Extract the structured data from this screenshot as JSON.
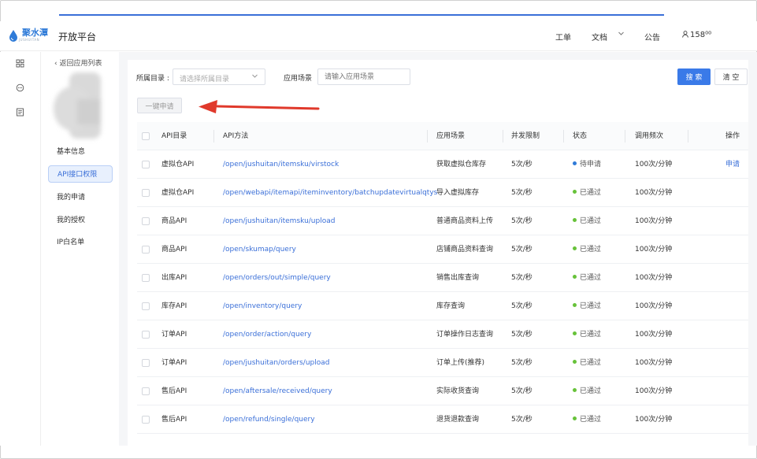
{
  "header": {
    "logo_text": "聚水潭",
    "logo_sub": "JUSHUITAN",
    "title": "开放平台",
    "nav": {
      "workorder": "工单",
      "docs": "文档",
      "notice": "公告",
      "user": "158⁰⁰"
    }
  },
  "sidebar": {
    "back": "返回应用列表",
    "items": [
      {
        "label": "基本信息"
      },
      {
        "label": "API接口权限"
      },
      {
        "label": "我的申请"
      },
      {
        "label": "我的授权"
      },
      {
        "label": "IP白名单"
      }
    ]
  },
  "filters": {
    "category_label": "所属目录 :",
    "category_placeholder": "请选择所属目录",
    "scene_label": "应用场景",
    "scene_placeholder": "请输入应用场景",
    "search_btn": "搜 索",
    "clear_btn": "清 空",
    "apply_btn": "一键申请"
  },
  "table": {
    "headers": {
      "category": "API目录",
      "method": "API方法",
      "scene": "应用场景",
      "concurrency": "并发限制",
      "status": "状态",
      "frequency": "调用频次",
      "op": "操作"
    },
    "rows": [
      {
        "category": "虚拟仓API",
        "method": "/open/jushuitan/itemsku/virstock",
        "scene": "获取虚拟仓库存",
        "concurrency": "5次/秒",
        "status": "待申请",
        "status_color": "#2f7bd8",
        "frequency": "100次/分钟",
        "op": "申请"
      },
      {
        "category": "虚拟仓API",
        "method": "/open/webapi/itemapi/iteminventory/batchupdatevirtualqtys",
        "scene": "导入虚拟库存",
        "concurrency": "5次/秒",
        "status": "已通过",
        "status_color": "#67c23a",
        "frequency": "100次/分钟",
        "op": ""
      },
      {
        "category": "商品API",
        "method": "/open/jushuitan/itemsku/upload",
        "scene": "普通商品资料上传",
        "concurrency": "5次/秒",
        "status": "已通过",
        "status_color": "#67c23a",
        "frequency": "100次/分钟",
        "op": ""
      },
      {
        "category": "商品API",
        "method": "/open/skumap/query",
        "scene": "店铺商品资料查询",
        "concurrency": "5次/秒",
        "status": "已通过",
        "status_color": "#67c23a",
        "frequency": "100次/分钟",
        "op": ""
      },
      {
        "category": "出库API",
        "method": "/open/orders/out/simple/query",
        "scene": "销售出库查询",
        "concurrency": "5次/秒",
        "status": "已通过",
        "status_color": "#67c23a",
        "frequency": "100次/分钟",
        "op": ""
      },
      {
        "category": "库存API",
        "method": "/open/inventory/query",
        "scene": "库存查询",
        "concurrency": "5次/秒",
        "status": "已通过",
        "status_color": "#67c23a",
        "frequency": "100次/分钟",
        "op": ""
      },
      {
        "category": "订单API",
        "method": "/open/order/action/query",
        "scene": "订单操作日志查询",
        "concurrency": "5次/秒",
        "status": "已通过",
        "status_color": "#67c23a",
        "frequency": "100次/分钟",
        "op": ""
      },
      {
        "category": "订单API",
        "method": "/open/jushuitan/orders/upload",
        "scene": "订单上传(推荐)",
        "concurrency": "5次/秒",
        "status": "已通过",
        "status_color": "#67c23a",
        "frequency": "100次/分钟",
        "op": ""
      },
      {
        "category": "售后API",
        "method": "/open/aftersale/received/query",
        "scene": "实际收货查询",
        "concurrency": "5次/秒",
        "status": "已通过",
        "status_color": "#67c23a",
        "frequency": "100次/分钟",
        "op": ""
      },
      {
        "category": "售后API",
        "method": "/open/refund/single/query",
        "scene": "退货退款查询",
        "concurrency": "5次/秒",
        "status": "已通过",
        "status_color": "#67c23a",
        "frequency": "100次/分钟",
        "op": ""
      }
    ]
  },
  "colors": {
    "accent": "#3a7ae8",
    "link": "#3a6fd8",
    "success": "#67c23a",
    "annotation_arrow": "#e0392b"
  },
  "icons": {
    "strip": [
      "grid-icon",
      "chat-icon",
      "document-icon"
    ]
  }
}
